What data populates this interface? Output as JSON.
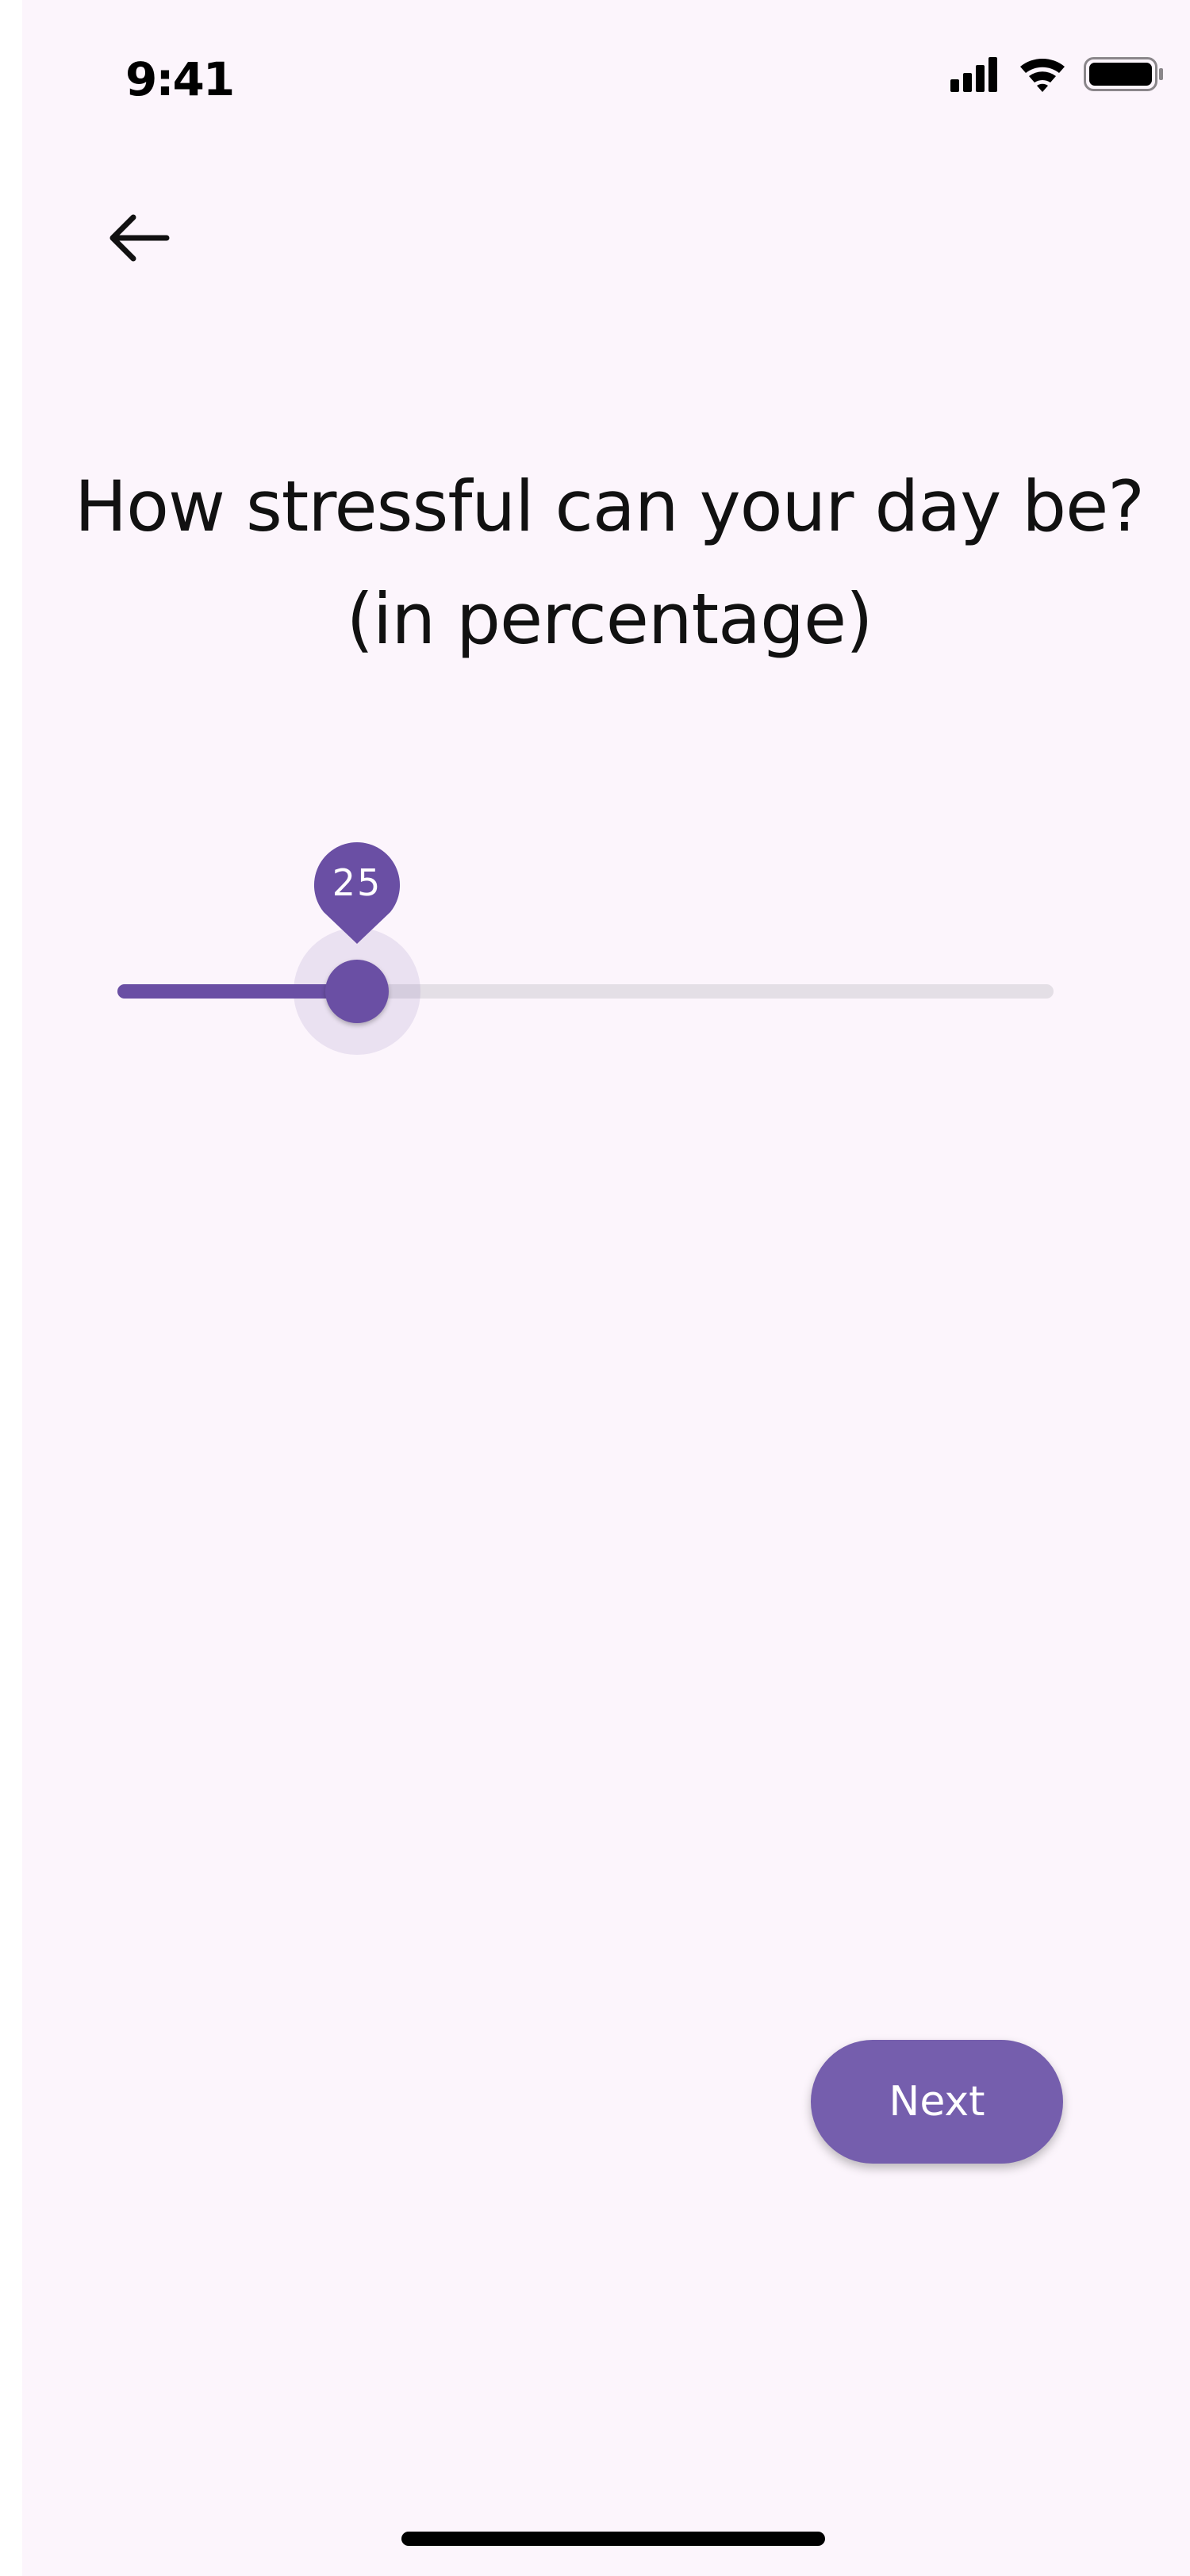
{
  "status_bar": {
    "time": "9:41",
    "icons": [
      "cellular-signal-icon",
      "wifi-icon",
      "battery-icon"
    ]
  },
  "navigation": {
    "back_icon": "arrow-left-icon"
  },
  "question": {
    "text": "How stressful can your day be? (in percentage)"
  },
  "slider": {
    "value": 25,
    "min": 0,
    "max": 100,
    "value_label": "25"
  },
  "actions": {
    "next_label": "Next"
  },
  "colors": {
    "background": "#fcf5fc",
    "accent": "#6a4fa4",
    "button": "#755ead",
    "inactive_track": "#e4dfe6",
    "text": "#111111"
  }
}
